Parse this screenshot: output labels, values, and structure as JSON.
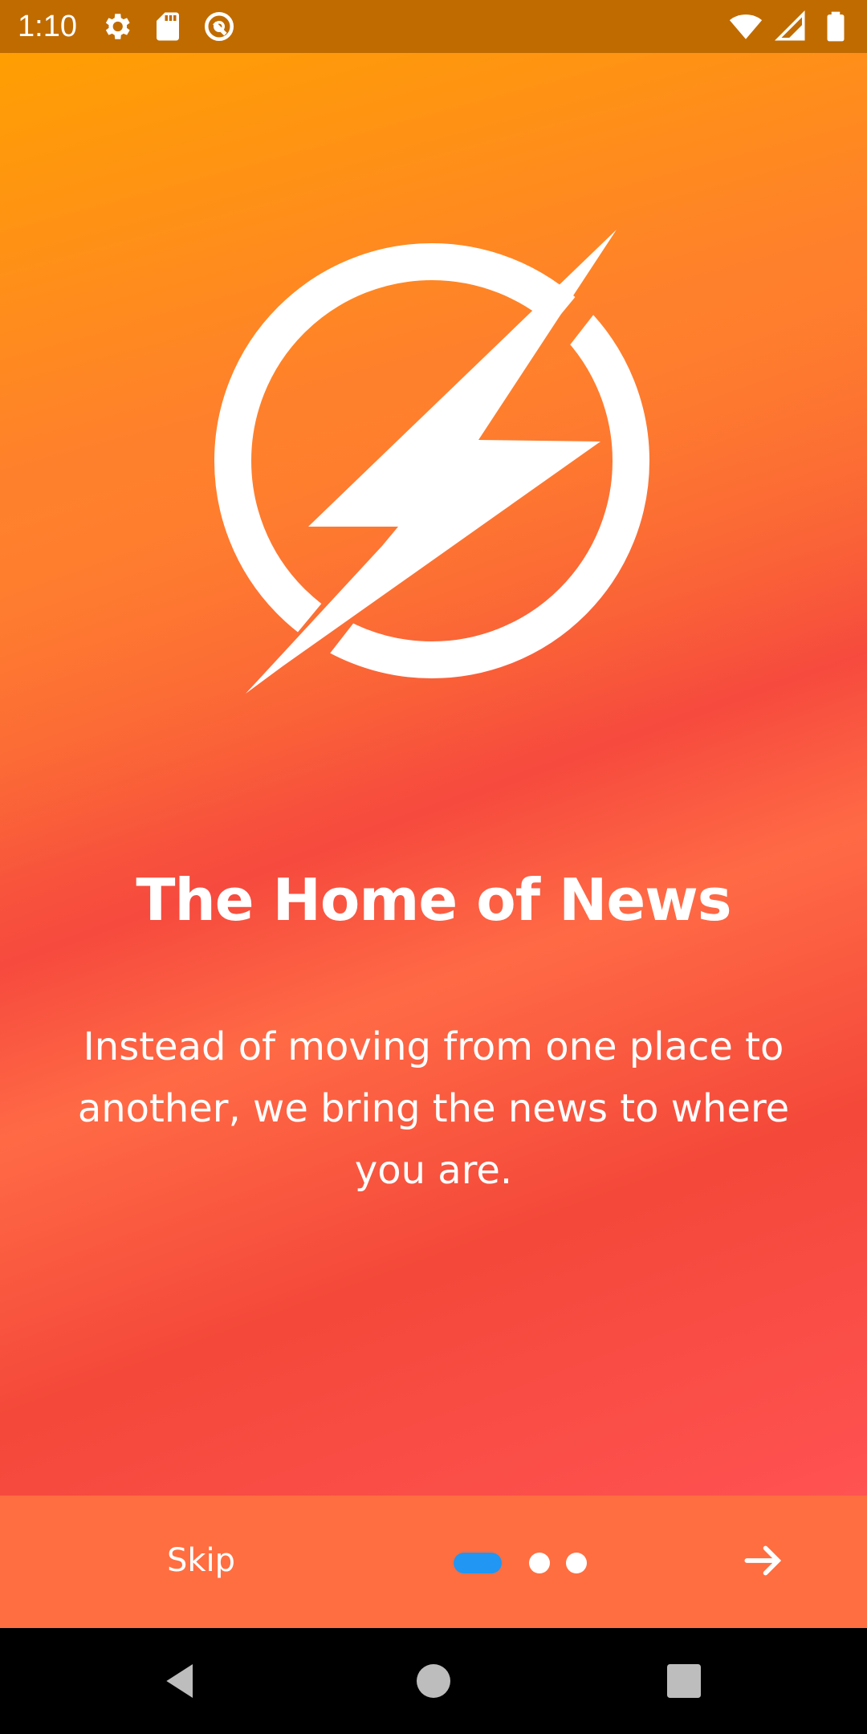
{
  "status_bar": {
    "time": "1:10",
    "left_icons": [
      "gear-icon",
      "sd-card-icon",
      "vpn-key-icon"
    ],
    "right_icons": [
      "wifi-icon",
      "cell-signal-icon",
      "battery-icon"
    ],
    "background": "#C06B00"
  },
  "onboarding": {
    "logo": "lightning-bolt-logo",
    "title": "The Home of News",
    "body": "Instead of moving from one place to another, we bring the news to where you are.",
    "gradient": [
      "#FF9A00",
      "#FF7A35",
      "#F64A3E",
      "#FF5252"
    ]
  },
  "bottom_bar": {
    "skip_label": "Skip",
    "page_count": 3,
    "active_page": 1,
    "active_dot_color": "#2196F3",
    "next_icon": "arrow-right-icon",
    "background": "#FF6E40"
  },
  "nav_bar": {
    "buttons": [
      "back-icon",
      "home-icon",
      "recents-icon"
    ]
  }
}
